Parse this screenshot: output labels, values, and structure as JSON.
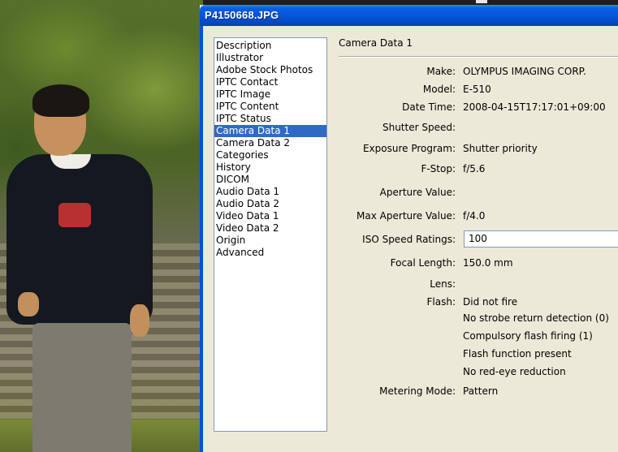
{
  "window": {
    "title": "P4150668.JPG"
  },
  "categories": [
    {
      "label": "Description",
      "selected": false
    },
    {
      "label": "Illustrator",
      "selected": false
    },
    {
      "label": "Adobe Stock Photos",
      "selected": false
    },
    {
      "label": "IPTC Contact",
      "selected": false
    },
    {
      "label": "IPTC Image",
      "selected": false
    },
    {
      "label": "IPTC Content",
      "selected": false
    },
    {
      "label": "IPTC Status",
      "selected": false
    },
    {
      "label": "Camera Data 1",
      "selected": true
    },
    {
      "label": "Camera Data 2",
      "selected": false
    },
    {
      "label": "Categories",
      "selected": false
    },
    {
      "label": "History",
      "selected": false
    },
    {
      "label": "DICOM",
      "selected": false
    },
    {
      "label": "Audio Data 1",
      "selected": false
    },
    {
      "label": "Audio Data 2",
      "selected": false
    },
    {
      "label": "Video Data 1",
      "selected": false
    },
    {
      "label": "Video Data 2",
      "selected": false
    },
    {
      "label": "Origin",
      "selected": false
    },
    {
      "label": "Advanced",
      "selected": false
    }
  ],
  "panel": {
    "title": "Camera Data 1",
    "fields": [
      {
        "label": "Make:",
        "value": "OLYMPUS IMAGING CORP."
      },
      {
        "label": "Model:",
        "value": "E-510"
      },
      {
        "label": "Date Time:",
        "value": "2008-04-15T17:17:01+09:00"
      },
      {
        "label": "Shutter Speed:",
        "value": ""
      },
      {
        "label": "Exposure Program:",
        "value": "Shutter priority"
      },
      {
        "label": "F-Stop:",
        "value": "f/5.6"
      },
      {
        "label": "Aperture Value:",
        "value": ""
      },
      {
        "label": "Max Aperture Value:",
        "value": "f/4.0"
      },
      {
        "label": "ISO Speed Ratings:",
        "value": "100"
      },
      {
        "label": "Focal Length:",
        "value": "150.0 mm"
      },
      {
        "label": "Lens:",
        "value": ""
      },
      {
        "label": "Flash:",
        "value": "Did not fire"
      },
      {
        "label": "Metering Mode:",
        "value": "Pattern"
      }
    ],
    "flash_details": [
      "No strobe return detection (0)",
      "Compulsory flash firing (1)",
      "Flash function present",
      "No red-eye reduction"
    ]
  },
  "colors": {
    "titlebar": "#0453d4",
    "selection": "#316ac5",
    "dialog_bg": "#ece9d8"
  }
}
